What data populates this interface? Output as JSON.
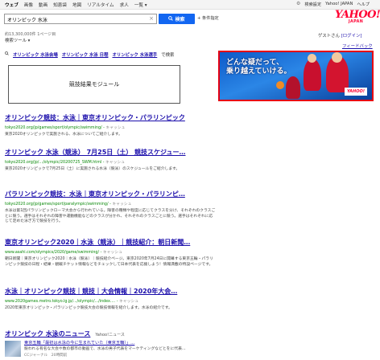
{
  "nav": {
    "tabs": [
      "ウェブ",
      "画像",
      "動画",
      "知恵袋",
      "地図",
      "リアルタイム",
      "求人",
      "一覧 ▾"
    ],
    "active_index": 0
  },
  "top_links": {
    "settings": "検索設定",
    "japan_top": "Yahoo! JAPAN",
    "help": "ヘルプ"
  },
  "logo": {
    "main": "YAHOO!",
    "sub": "JAPAN"
  },
  "search": {
    "query": "オリンピック 水泳",
    "button_label": "検索",
    "condition_label": "+ 条件指定"
  },
  "results_meta": {
    "count_text": "約13,300,000件 1ページ目",
    "tools_label": "検索ツール ▾",
    "user_text": "ゲストさん",
    "login_label": "[ログイン]",
    "feedback_label": "フィードバック"
  },
  "related": {
    "items": [
      "オリンピック 水泳会場",
      "オリンピック 水泳 日程",
      "オリンピック 水泳選手"
    ],
    "suffix": "で検索"
  },
  "module_label": "競技結果モジュール",
  "ad": {
    "line1": "どんな疑だって、",
    "line2": "乗り越えていける。",
    "brand": "YAHOO!"
  },
  "results": [
    {
      "title": "オリンピック競技：水泳｜東京オリンピック・パラリンピック",
      "url": "tokyo2020.org/jp/games/sport/olympic/swimming/",
      "cache": "キャッシュ",
      "snippet": "東京2020オリンピックで実施される、水泳についてご紹介します。"
    },
    {
      "title": "オリンピック 水泳（競泳） 7月25日（土） 競技スケジュー…",
      "url": "tokyo2020.org/jp/.../olympic/20200725_SWM.html",
      "cache": "キャッシュ",
      "snippet": "東京2020オリンピックで7月25日（土）に実施される水泳（競泳）のスケジュールをご紹介します。"
    },
    {
      "title": "パラリンピック競技：水泳｜東京オリンピック・パラリンピ…",
      "url": "tokyo2020.org/jp/games/sport/paralympic/swimming/",
      "cache": "キャッシュ",
      "snippet": "水泳は第1回パラリンピックローマ大会から行われている。障害の種類や程度に応じてクラスを分け、それぞれのクラスごとに競う。選手はそれぞれの障害や運動機能などのクラスが分かれ、それぞれのクラスごとに競う。選手はそれぞれに応じて定めた泳ぎ方で競技を行う。"
    },
    {
      "title": "東京オリンピック2020｜水泳（競泳）｜競技紹介：朝日新聞…",
      "url": "www.asahi.com/olympics/2020/game/swimming/",
      "cache": "キャッシュ",
      "snippet": "朝日新聞｜東京オリンピック2020｜水泳（競泳）｜競技紹介ページ。東京2020年7月24日に開幕する東京五輪・パラリンピック競技の日程・結果・観戦チケット情報などをチェックして日本代表を応援しよう！情報満載の特設ページです。"
    },
    {
      "title": "水泳｜オリンピック競技｜競技｜大会情報｜2020年大会…",
      "url": "www.2020games.metro.tokyo.lg.jp/.../olympic/.../index.…",
      "cache": "キャッシュ",
      "snippet": "2020年東京オリンピック・パラリンピック競技大会の競技情報を紹介します。水泳の紹介です。"
    }
  ],
  "news": {
    "title": "オリンピック 水泳のニュース",
    "source": "Yahoo!ニュース",
    "item_title": "東京五輪「最初は水泳の今に生まれていた（東京五輪）」…",
    "item_snippet": "競われる有名な大会や数の都市の動画で、水泳の男子代表をマーケティングなどとをに代表…",
    "item_meta": "CCジャーナル　20時間前"
  }
}
